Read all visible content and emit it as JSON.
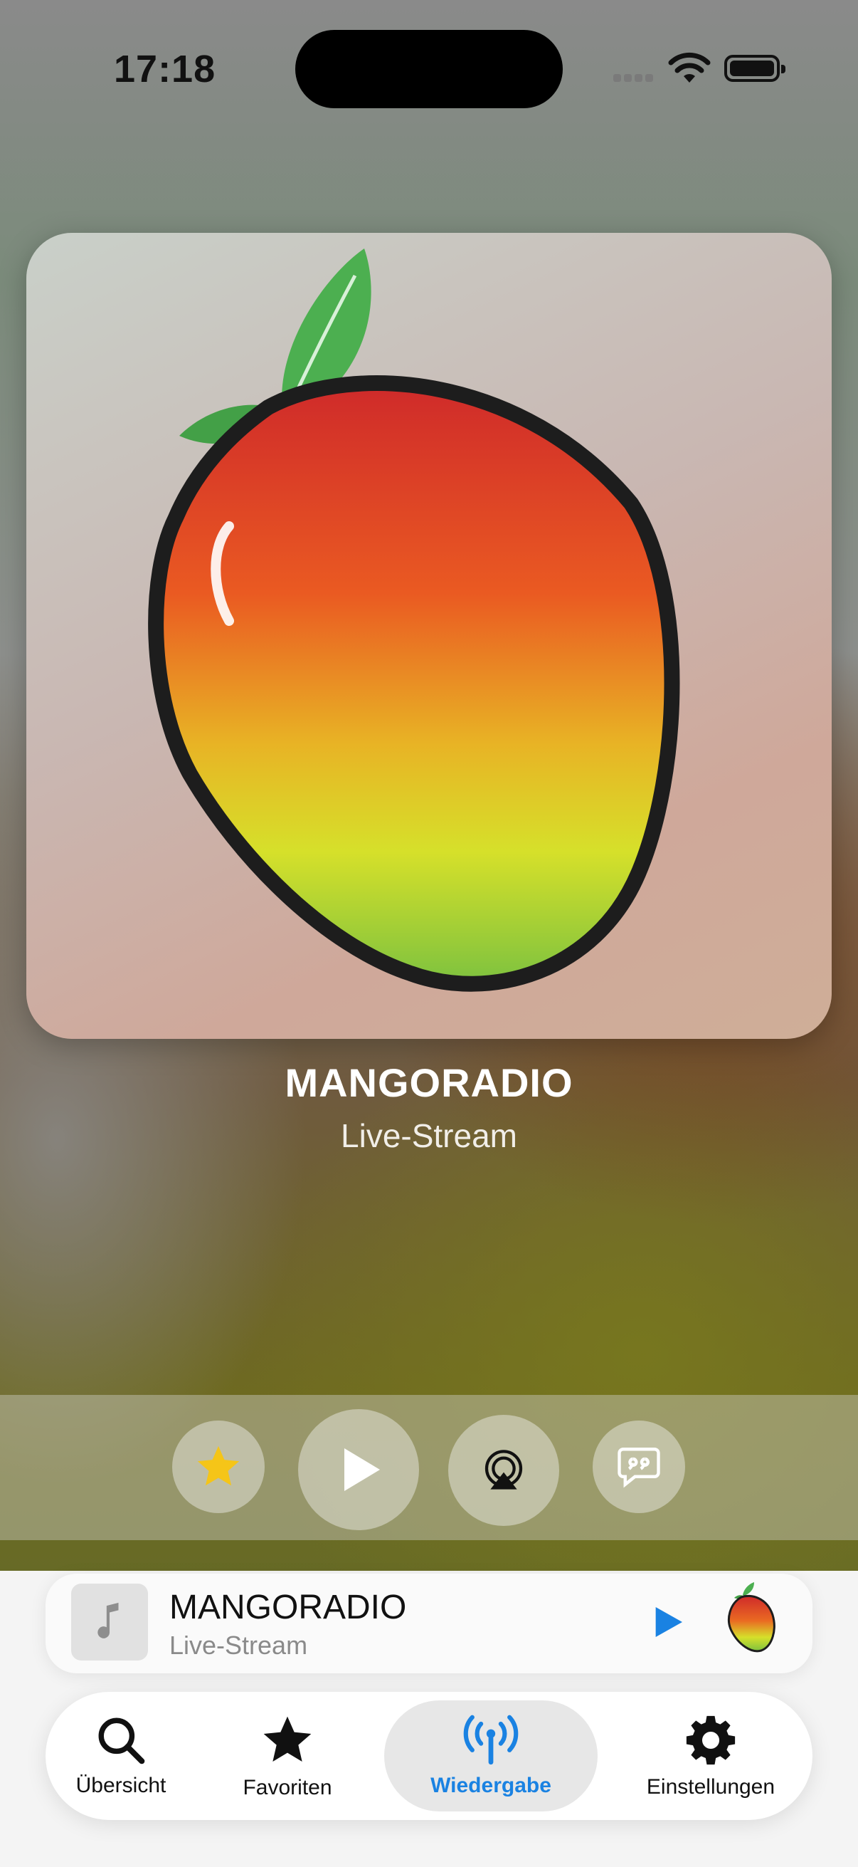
{
  "status_bar": {
    "time": "17:18"
  },
  "now_playing": {
    "title": "MANGORADIO",
    "subtitle": "Live-Stream",
    "artwork": "mango-logo"
  },
  "controls": {
    "favorite": {
      "icon": "star-icon",
      "color": "#f5c518"
    },
    "play": {
      "icon": "play-icon"
    },
    "airplay": {
      "icon": "airplay-icon"
    },
    "chat": {
      "icon": "chat-quote-icon"
    }
  },
  "mini_player": {
    "title": "MANGORADIO",
    "subtitle": "Live-Stream",
    "play_color": "#1a82e2"
  },
  "tabs": [
    {
      "label": "Übersicht",
      "icon": "search-icon"
    },
    {
      "label": "Favoriten",
      "icon": "star-icon"
    },
    {
      "label": "Wiedergabe",
      "icon": "broadcast-icon",
      "active": true
    },
    {
      "label": "Einstellungen",
      "icon": "gear-icon"
    }
  ],
  "colors": {
    "accent": "#1a82e2",
    "favorite": "#f5c518"
  }
}
